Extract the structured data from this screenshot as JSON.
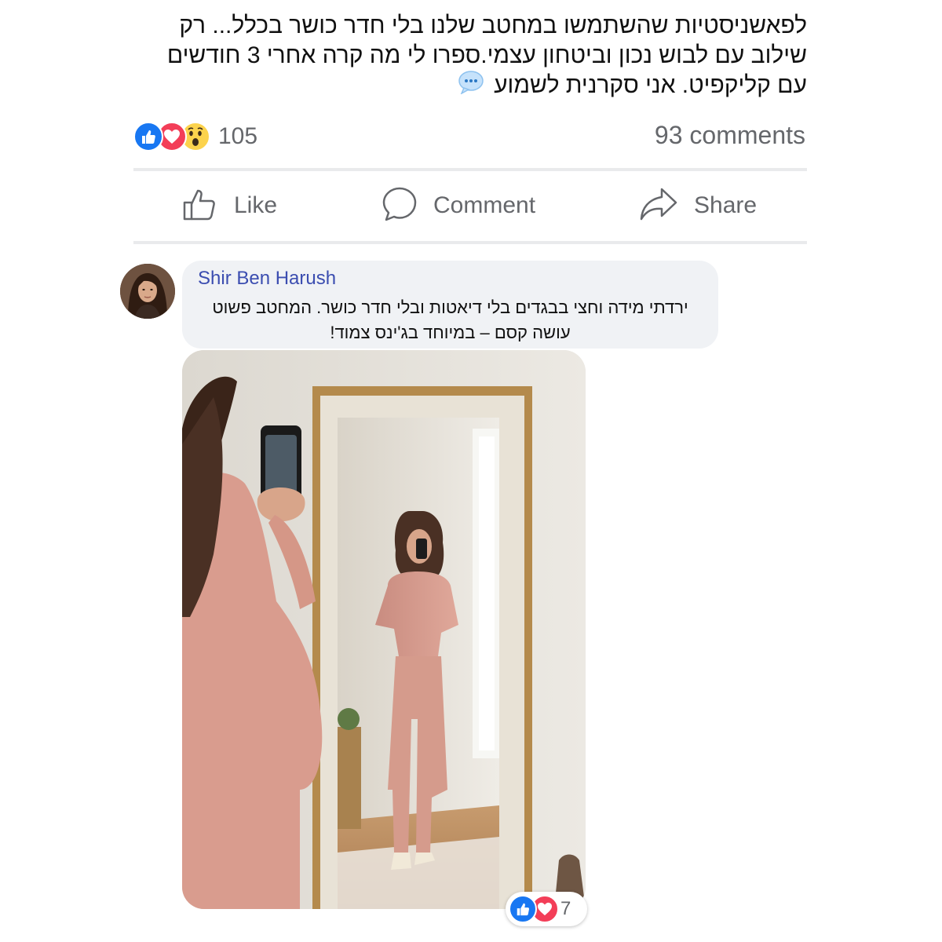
{
  "post": {
    "text": "לפאשניסטיות שהשתמשו במחטב שלנו בלי חדר כושר בכלל... רק שילוב עם לבוש נכון וביטחון עצמי.ספרו לי מה קרה אחרי 3 חודשים עם קליקפיט. אני סקרנית לשמוע",
    "emoji_icon": "speech-bubble-icon"
  },
  "stats": {
    "reaction_icons": [
      "like-icon",
      "love-icon",
      "wow-icon"
    ],
    "reaction_count": "105",
    "comments_count": "93 comments"
  },
  "actions": {
    "like_label": "Like",
    "comment_label": "Comment",
    "share_label": "Share"
  },
  "comment": {
    "author": "Shir Ben Harush",
    "text": "ירדתי מידה וחצי בבגדים בלי דיאטות ובלי חדר כושר. המחטב פשוט עושה קסם – במיוחד בג'ינס צמוד!",
    "image_icon": "mirror-selfie-photo",
    "reactions": {
      "icons": [
        "like-icon",
        "love-icon"
      ],
      "count": "7"
    }
  },
  "colors": {
    "like_blue": "#1877f2",
    "love_red": "#f33e58",
    "wow_yellow": "#fcd34d",
    "author_blue": "#3b4db0",
    "muted_gray": "#65676b",
    "bubble_bg": "#f0f2f5"
  }
}
